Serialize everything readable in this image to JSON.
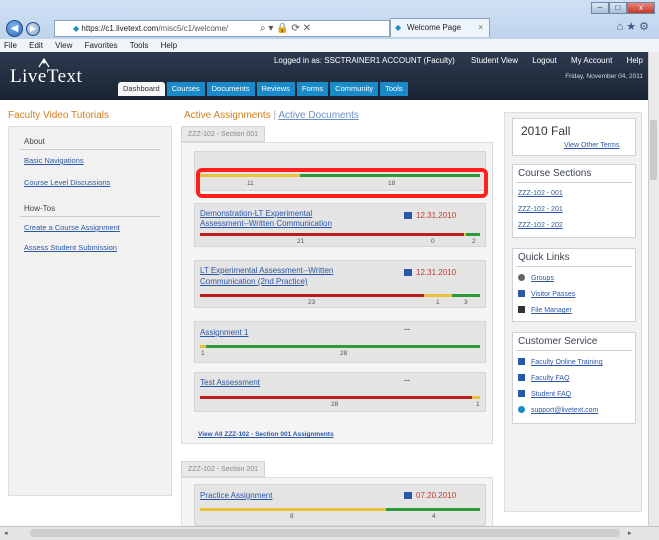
{
  "browser": {
    "url_host": "https://c1.livetext.com",
    "url_path": "/misc5/c1/welcome/",
    "tab_title": "Welcome Page",
    "menu": [
      "File",
      "Edit",
      "View",
      "Favorites",
      "Tools",
      "Help"
    ],
    "window_controls": [
      "–",
      "□",
      "x"
    ]
  },
  "header": {
    "logo": "LiveText",
    "logged_in": "Logged in as: SSCTRAINER1 ACCOUNT (Faculty)",
    "links": [
      "Student View",
      "Logout",
      "My Account",
      "Help"
    ],
    "date": "Friday, November 04, 2011",
    "tabs": [
      "Dashboard",
      "Courses",
      "Documents",
      "Reviews",
      "Forms",
      "Community",
      "Tools"
    ],
    "active_tab": "Dashboard"
  },
  "left": {
    "title": "Faculty Video Tutorials",
    "sections": [
      {
        "heading": "About",
        "links": [
          "Basic Navigations",
          "Course Level Discussions"
        ]
      },
      {
        "heading": "How-Tos",
        "links": [
          "Create a Course Assignment",
          "Assess Student Submission"
        ]
      }
    ]
  },
  "center": {
    "heading_active": "Active Assignments",
    "heading_sep": "|",
    "heading_docs": "Active Documents",
    "section1": "ZZZ-102 - Section 001",
    "section2": "ZZZ-102 - Section 201",
    "view_all": "View All ZZZ-102 - Section 001 Assignments",
    "cards": [
      {
        "title_line1": "",
        "title_line2": "",
        "date": "",
        "bars": {
          "red": 0,
          "yellow": 11,
          "green": 18
        }
      },
      {
        "title_line1": "Demonstration-LT Experimental",
        "title_line2": "Assessment--Written Communication",
        "date": "12.31.2010",
        "bars": {
          "red": 21,
          "yellow": 0,
          "green": 2
        }
      },
      {
        "title_line1": "LT Experimental Assessment--Written",
        "title_line2": "Communication (2nd Practice)",
        "date": "12.31.2010",
        "bars": {
          "red": 23,
          "yellow": 1,
          "green": 3
        }
      },
      {
        "title_line1": "Assignment 1",
        "title_line2": "",
        "date": "--",
        "bars": {
          "red": 0,
          "yellow": 1,
          "green": 28
        }
      },
      {
        "title_line1": "Test Assessment",
        "title_line2": "",
        "date": "--",
        "bars": {
          "red": 28,
          "yellow": 1,
          "green": 0
        }
      },
      {
        "title_line1": "Practice Assignment",
        "title_line2": "",
        "date": "07.20.2010",
        "bars": {
          "red": 0,
          "yellow": 8,
          "green": 4
        }
      }
    ],
    "bar_labels": [
      [
        "11",
        "18"
      ],
      [
        "21",
        "0",
        "2"
      ],
      [
        "23",
        "1",
        "3"
      ],
      [
        "1",
        "28"
      ],
      [
        "28",
        "1"
      ],
      [
        "8",
        "4"
      ]
    ]
  },
  "right": {
    "term": "2010 Fall",
    "other_terms": "View Other Terms",
    "course_sections_title": "Course Sections",
    "course_sections": [
      "ZZZ-102 - 001",
      "ZZZ-102 - 201",
      "ZZZ-102 - 202"
    ],
    "quick_links_title": "Quick Links",
    "quick_links": [
      "Groups",
      "Visitor Passes",
      "File Manager"
    ],
    "service_title": "Customer Service",
    "service_links": [
      "Faculty Online Training",
      "Faculty FAQ",
      "Student FAQ",
      "support@livetext.com"
    ]
  },
  "colors": {
    "accent_orange": "#d77d1b",
    "link_blue": "#2a58a6",
    "tab_blue": "#1b8ac9",
    "bar_red": "#b91d1d",
    "bar_yellow": "#e8c23a",
    "bar_green": "#2e9b3a",
    "highlight": "#ff1f1f"
  }
}
